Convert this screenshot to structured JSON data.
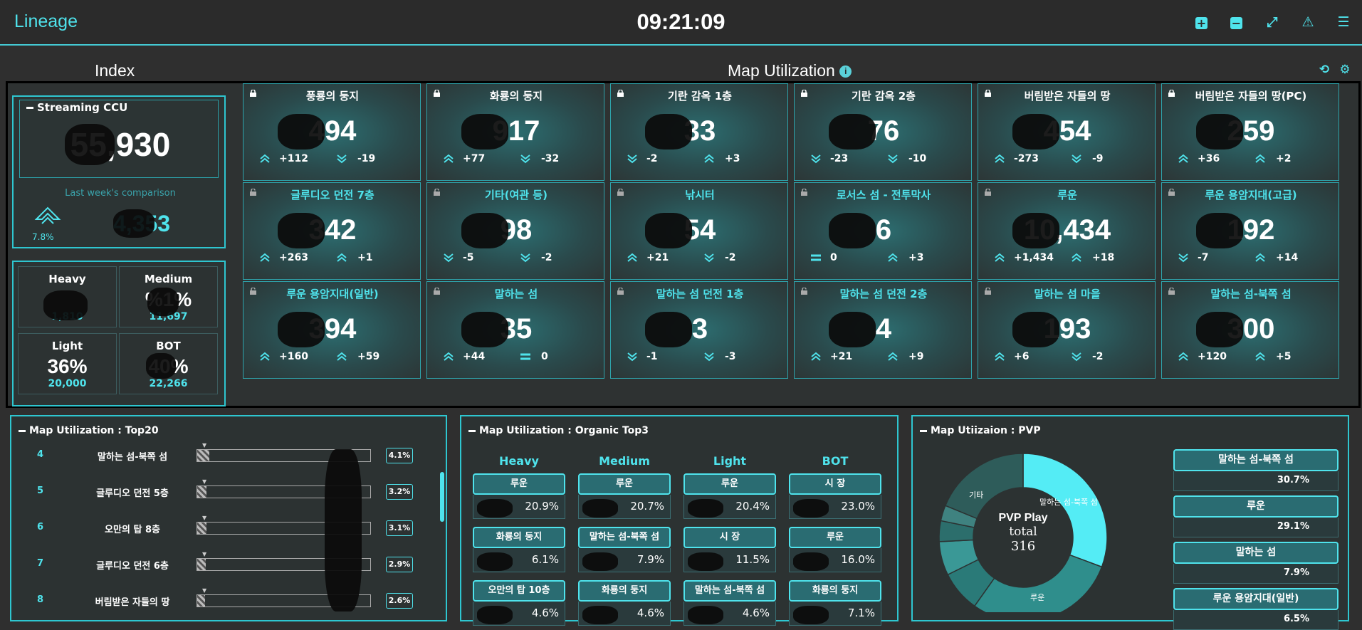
{
  "header": {
    "app_title": "Lineage",
    "clock": "09:21:09"
  },
  "sections": {
    "index_title": "Index",
    "map_title": "Map Utilization",
    "info_icon": "i"
  },
  "ccu": {
    "title": "Streaming CCU",
    "value": "55,930",
    "comparison_label": "Last week's comparison",
    "change_pct": "7.8%",
    "last_week_value": "4,353"
  },
  "segments": [
    {
      "label": "Heavy",
      "pct": "",
      "count": "1,810"
    },
    {
      "label": "Medium",
      "pct": "%1%",
      "count": "11,697"
    },
    {
      "label": "Light",
      "pct": "36%",
      "count": "20,000"
    },
    {
      "label": "BOT",
      "pct": "40%",
      "count": "22,266"
    }
  ],
  "maps": [
    {
      "name": "풍룡의 둥지",
      "value": "494",
      "d1": "+112",
      "d2": "-19",
      "a1": "up",
      "a2": "down",
      "locked": true
    },
    {
      "name": "화룡의 둥지",
      "value": "917",
      "d1": "+77",
      "d2": "-32",
      "a1": "up",
      "a2": "down",
      "locked": true
    },
    {
      "name": "기란 감옥 1층",
      "value": "33",
      "d1": "-2",
      "d2": "+3",
      "a1": "down",
      "a2": "up",
      "locked": true
    },
    {
      "name": "기란 감옥 2층",
      "value": "76",
      "d1": "-23",
      "d2": "-10",
      "a1": "down",
      "a2": "down",
      "locked": true
    },
    {
      "name": "버림받은 자들의 땅",
      "value": "454",
      "d1": "-273",
      "d2": "-9",
      "a1": "up",
      "a2": "down",
      "locked": true
    },
    {
      "name": "버림받은 자들의 땅(PC)",
      "value": "259",
      "d1": "+36",
      "d2": "+2",
      "a1": "up",
      "a2": "up",
      "locked": true
    },
    {
      "name": "글루디오 던전 7층",
      "value": "342",
      "d1": "+263",
      "d2": "+1",
      "a1": "up",
      "a2": "up",
      "locked": false
    },
    {
      "name": "기타(여관 등)",
      "value": "98",
      "d1": "-5",
      "d2": "-2",
      "a1": "down",
      "a2": "down",
      "locked": false
    },
    {
      "name": "낚시터",
      "value": "54",
      "d1": "+21",
      "d2": "-2",
      "a1": "up",
      "a2": "down",
      "locked": false
    },
    {
      "name": "로서스 섬 - 전투막사",
      "value": "6",
      "d1": "0",
      "d2": "+3",
      "a1": "eq",
      "a2": "up",
      "locked": false
    },
    {
      "name": "루운",
      "value": "10,434",
      "d1": "+1,434",
      "d2": "+18",
      "a1": "up",
      "a2": "up",
      "locked": false
    },
    {
      "name": "루운 용암지대(고급)",
      "value": "192",
      "d1": "-7",
      "d2": "+14",
      "a1": "down",
      "a2": "up",
      "locked": false
    },
    {
      "name": "루운 용암지대(일반)",
      "value": "394",
      "d1": "+160",
      "d2": "+59",
      "a1": "up",
      "a2": "up",
      "locked": false
    },
    {
      "name": "말하는 섬",
      "value": "35",
      "d1": "+44",
      "d2": "0",
      "a1": "up",
      "a2": "eq",
      "locked": false
    },
    {
      "name": "말하는 섬 던전 1층",
      "value": "3",
      "d1": "-1",
      "d2": "-3",
      "a1": "down",
      "a2": "down",
      "locked": false
    },
    {
      "name": "말하는 섬 던전 2층",
      "value": "4",
      "d1": "+21",
      "d2": "+9",
      "a1": "up",
      "a2": "up",
      "locked": false
    },
    {
      "name": "말하는 섬 마을",
      "value": "193",
      "d1": "+6",
      "d2": "-2",
      "a1": "up",
      "a2": "down",
      "locked": false
    },
    {
      "name": "말하는 섬-북쪽 섬",
      "value": "300",
      "d1": "+120",
      "d2": "+5",
      "a1": "up",
      "a2": "up",
      "locked": false
    }
  ],
  "top20": {
    "title": "Map Utilization : Top20",
    "rows": [
      {
        "rank": "4",
        "name": "말하는 섬-북쪽 섬",
        "pct": "4.1%",
        "fill": 0.04
      },
      {
        "rank": "5",
        "name": "글루디오 던전 5층",
        "pct": "3.2%",
        "fill": 0.032
      },
      {
        "rank": "6",
        "name": "오만의 탑 8층",
        "pct": "3.1%",
        "fill": 0.031
      },
      {
        "rank": "7",
        "name": "글루디오 던전 6층",
        "pct": "2.9%",
        "fill": 0.029
      },
      {
        "rank": "8",
        "name": "버림받은 자들의 땅",
        "pct": "2.6%",
        "fill": 0.026
      }
    ]
  },
  "organic": {
    "title": "Map Utilization : Organic Top3",
    "headers": [
      "Heavy",
      "Medium",
      "Light",
      "BOT"
    ],
    "cells": [
      [
        {
          "name": "루운",
          "pct": "20.9%"
        },
        {
          "name": "루운",
          "pct": "20.7%"
        },
        {
          "name": "루운",
          "pct": "20.4%"
        },
        {
          "name": "시 장",
          "pct": "23.0%"
        }
      ],
      [
        {
          "name": "화룡의 둥지",
          "pct": "6.1%"
        },
        {
          "name": "말하는 섬-북쪽 섬",
          "pct": "7.9%"
        },
        {
          "name": "시 장",
          "pct": "11.5%"
        },
        {
          "name": "루운",
          "pct": "16.0%"
        }
      ],
      [
        {
          "name": "오만의 탑 10층",
          "pct": "4.6%"
        },
        {
          "name": "화룡의 둥지",
          "pct": "4.6%"
        },
        {
          "name": "말하는 섬-북쪽 섬",
          "pct": "4.6%"
        },
        {
          "name": "화룡의 둥지",
          "pct": "7.1%"
        }
      ]
    ]
  },
  "pvp": {
    "title": "Map Utiizaion : PVP",
    "center_title": "PVP Play",
    "center_sub": "total",
    "center_total": "316",
    "slice_labels": {
      "top": "말하는 섬-북쪽 섬",
      "bottom": "루운",
      "left": "기타"
    },
    "list": [
      {
        "name": "말하는 섬-북쪽 섬",
        "pct": "30.7%"
      },
      {
        "name": "루운",
        "pct": "29.1%"
      },
      {
        "name": "말하는 섬",
        "pct": "7.9%"
      },
      {
        "name": "루운 용암지대(일반)",
        "pct": "6.5%"
      }
    ]
  },
  "chart_data": {
    "type": "pie",
    "title": "PVP Play",
    "categories": [
      "말하는 섬-북쪽 섬",
      "루운",
      "기타 1",
      "기타 2",
      "기타 3",
      "기타 4",
      "기타"
    ],
    "values": [
      30.7,
      29.1,
      7.9,
      6.5,
      4,
      3,
      18.8
    ],
    "colors": [
      "#54ecf5",
      "#2f8e8c",
      "#2a7a78",
      "#3a9896",
      "#2c6e6c",
      "#3f8280",
      "#2e5c5a"
    ]
  }
}
